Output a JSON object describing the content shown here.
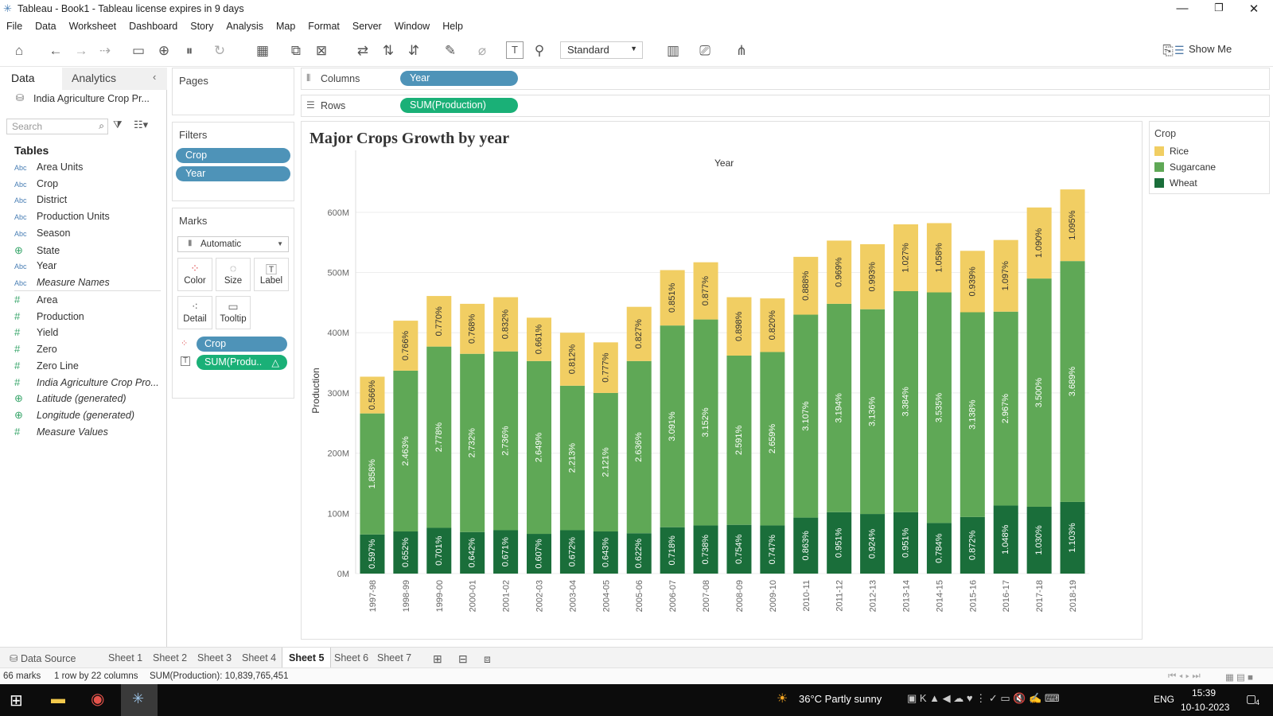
{
  "window": {
    "title": "Tableau - Book1 - Tableau license expires in 9 days"
  },
  "menu": [
    "File",
    "Data",
    "Worksheet",
    "Dashboard",
    "Story",
    "Analysis",
    "Map",
    "Format",
    "Server",
    "Window",
    "Help"
  ],
  "toolbar": {
    "fit_select": "Standard",
    "show_me": "Show Me"
  },
  "left_pane": {
    "tabs": [
      "Data",
      "Analytics"
    ],
    "datasource": "India Agriculture Crop Pr...",
    "search_placeholder": "Search",
    "tables_header": "Tables",
    "dimensions": [
      {
        "type": "Abc",
        "name": "Area Units"
      },
      {
        "type": "Abc",
        "name": "Crop"
      },
      {
        "type": "Abc",
        "name": "District"
      },
      {
        "type": "Abc",
        "name": "Production Units"
      },
      {
        "type": "Abc",
        "name": "Season"
      },
      {
        "type": "globe",
        "name": "State"
      },
      {
        "type": "Abc",
        "name": "Year"
      },
      {
        "type": "Abc",
        "name": "Measure Names",
        "italic": true
      }
    ],
    "measures": [
      {
        "type": "#",
        "name": "Area"
      },
      {
        "type": "#",
        "name": "Production"
      },
      {
        "type": "#",
        "name": "Yield"
      },
      {
        "type": "#",
        "name": "Zero"
      },
      {
        "type": "#",
        "name": "Zero Line"
      },
      {
        "type": "#",
        "name": "India Agriculture Crop Pro...",
        "italic": true
      },
      {
        "type": "globe",
        "name": "Latitude (generated)",
        "italic": true
      },
      {
        "type": "globe",
        "name": "Longitude (generated)",
        "italic": true
      },
      {
        "type": "#",
        "name": "Measure Values",
        "italic": true
      }
    ]
  },
  "pages": {
    "label": "Pages"
  },
  "filters": {
    "label": "Filters",
    "pills": [
      "Crop",
      "Year"
    ]
  },
  "marks": {
    "label": "Marks",
    "type": "Automatic",
    "buttons": [
      "Color",
      "Size",
      "Label",
      "Detail",
      "Tooltip"
    ],
    "pills": [
      "Crop",
      "SUM(Produ.."
    ]
  },
  "shelves": {
    "columns_label": "Columns",
    "columns_pill": "Year",
    "rows_label": "Rows",
    "rows_pill": "SUM(Production)"
  },
  "legend": {
    "title": "Crop",
    "items": [
      {
        "name": "Rice",
        "color": "#f1ce63"
      },
      {
        "name": "Sugarcane",
        "color": "#5fa856"
      },
      {
        "name": "Wheat",
        "color": "#1a6e3a"
      }
    ]
  },
  "sheets": {
    "data_source": "Data Source",
    "tabs": [
      "Sheet 1",
      "Sheet 2",
      "Sheet 3",
      "Sheet 4",
      "Sheet 5",
      "Sheet 6",
      "Sheet 7"
    ],
    "active": "Sheet 5"
  },
  "status": {
    "marks": "66 marks",
    "layout": "1 row by 22 columns",
    "sum": "SUM(Production): 10,839,765,451"
  },
  "taskbar": {
    "weather": "36°C  Partly sunny",
    "lang": "ENG",
    "time": "15:39",
    "date": "10-10-2023",
    "notif": "4"
  },
  "chart_data": {
    "type": "bar",
    "stacked": true,
    "title": "Major Crops Growth by year",
    "xlabel": "Year",
    "ylabel": "Production",
    "ylim": [
      0,
      650000000
    ],
    "yticks": [
      "0M",
      "100M",
      "200M",
      "300M",
      "400M",
      "500M",
      "600M"
    ],
    "categories": [
      "1997-98",
      "1998-99",
      "1999-00",
      "2000-01",
      "2001-02",
      "2002-03",
      "2003-04",
      "2004-05",
      "2005-06",
      "2006-07",
      "2007-08",
      "2008-09",
      "2009-10",
      "2010-11",
      "2011-12",
      "2012-13",
      "2013-14",
      "2014-15",
      "2015-16",
      "2016-17",
      "2017-18",
      "2018-19"
    ],
    "series": [
      {
        "name": "Wheat",
        "color": "#1a6e3a",
        "values": [
          65,
          70,
          76,
          69,
          72,
          66,
          72,
          70,
          67,
          77,
          80,
          81,
          80,
          93,
          102,
          99,
          102,
          84,
          94,
          113,
          111,
          119
        ],
        "labels": [
          "0.597%",
          "0.652%",
          "0.701%",
          "0.642%",
          "0.671%",
          "0.607%",
          "0.672%",
          "0.643%",
          "0.622%",
          "0.718%",
          "0.738%",
          "0.754%",
          "0.747%",
          "0.863%",
          "0.951%",
          "0.924%",
          "0.951%",
          "0.784%",
          "0.872%",
          "1.048%",
          "1.030%",
          "1.103%"
        ]
      },
      {
        "name": "Sugarcane",
        "color": "#5fa856",
        "values": [
          201,
          267,
          301,
          296,
          297,
          287,
          240,
          230,
          286,
          335,
          342,
          281,
          288,
          337,
          346,
          340,
          367,
          383,
          340,
          322,
          379,
          400
        ],
        "labels": [
          "1.858%",
          "2.463%",
          "2.778%",
          "2.732%",
          "2.736%",
          "2.649%",
          "2.213%",
          "2.121%",
          "2.636%",
          "3.091%",
          "3.152%",
          "2.591%",
          "2.659%",
          "3.107%",
          "3.194%",
          "3.136%",
          "3.384%",
          "3.535%",
          "3.138%",
          "2.967%",
          "3.500%",
          "3.689%"
        ]
      },
      {
        "name": "Rice",
        "color": "#f1ce63",
        "values": [
          61,
          83,
          84,
          83,
          90,
          72,
          88,
          84,
          90,
          92,
          95,
          97,
          89,
          96,
          105,
          108,
          111,
          115,
          102,
          119,
          118,
          119
        ],
        "labels": [
          "0.566%",
          "0.766%",
          "0.770%",
          "0.768%",
          "0.832%",
          "0.661%",
          "0.812%",
          "0.777%",
          "0.827%",
          "0.851%",
          "0.877%",
          "0.898%",
          "0.820%",
          "0.888%",
          "0.969%",
          "0.993%",
          "1.027%",
          "1.058%",
          "0.939%",
          "1.097%",
          "1.090%",
          "1.095%"
        ]
      }
    ],
    "value_units": "millions"
  }
}
